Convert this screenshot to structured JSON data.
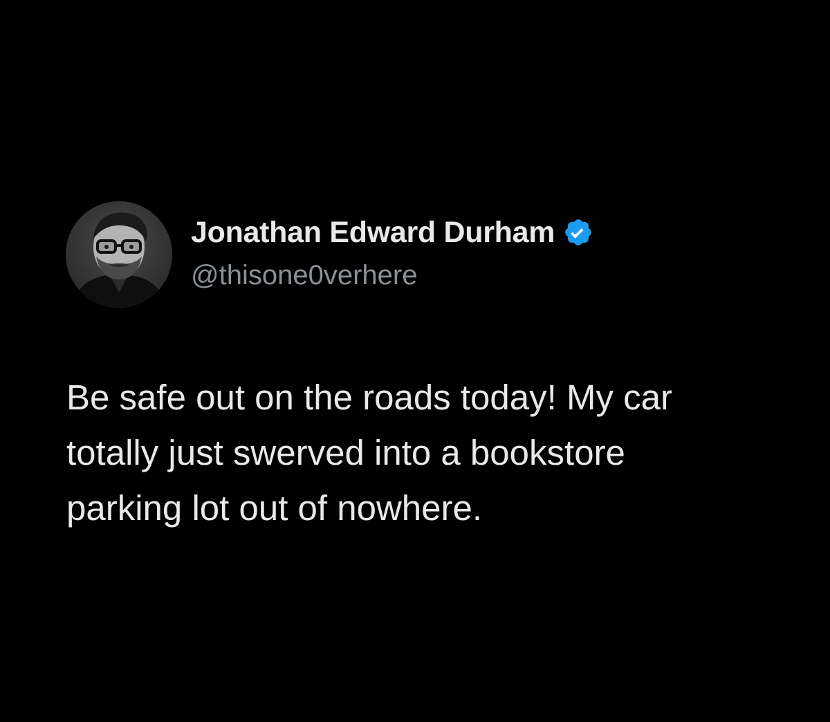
{
  "theme": {
    "background": "#000000",
    "text_color": "#e7e9ea",
    "handle_color": "#8b9096",
    "verified_badge_color": "#1d9bf0"
  },
  "author": {
    "display_name": "Jonathan Edward Durham",
    "handle": "@thisone0verhere",
    "verified": true,
    "verified_icon": "verified-badge-icon",
    "avatar": "grayscale-portrait-avatar"
  },
  "tweet": {
    "text_lines": [
      "Be safe out on the roads today! My car",
      "totally just swerved into a bookstore",
      "parking lot out of nowhere."
    ]
  }
}
